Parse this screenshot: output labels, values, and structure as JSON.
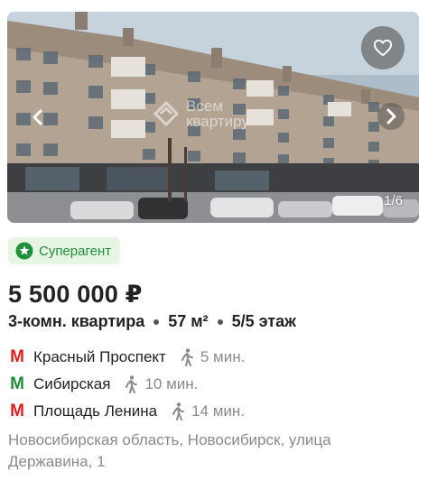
{
  "listing": {
    "photo": {
      "watermark_text": "Всем квартиру",
      "counter": "1/6",
      "favorite_icon": "heart-outline-icon",
      "prev_icon": "chevron-left-icon",
      "next_icon": "chevron-right-icon"
    },
    "badge": {
      "label": "Суперагент",
      "icon": "star-circle-icon",
      "color": "#1f8f3a",
      "background": "#e7f5e3"
    },
    "price": "5 500 000 ₽",
    "details": {
      "rooms": "3-комн. квартира",
      "area": "57 м²",
      "floor": "5/5 этаж"
    },
    "metro": [
      {
        "symbol": "M",
        "color": "#e0201f",
        "station": "Красный Проспект",
        "walk": "5 мин."
      },
      {
        "symbol": "M",
        "color": "#1f8f3a",
        "station": "Сибирская",
        "walk": "10 мин."
      },
      {
        "symbol": "M",
        "color": "#e0201f",
        "station": "Площадь Ленина",
        "walk": "14 мин."
      }
    ],
    "address": "Новосибирская область, Новосибирск, улица Державина, 1"
  }
}
